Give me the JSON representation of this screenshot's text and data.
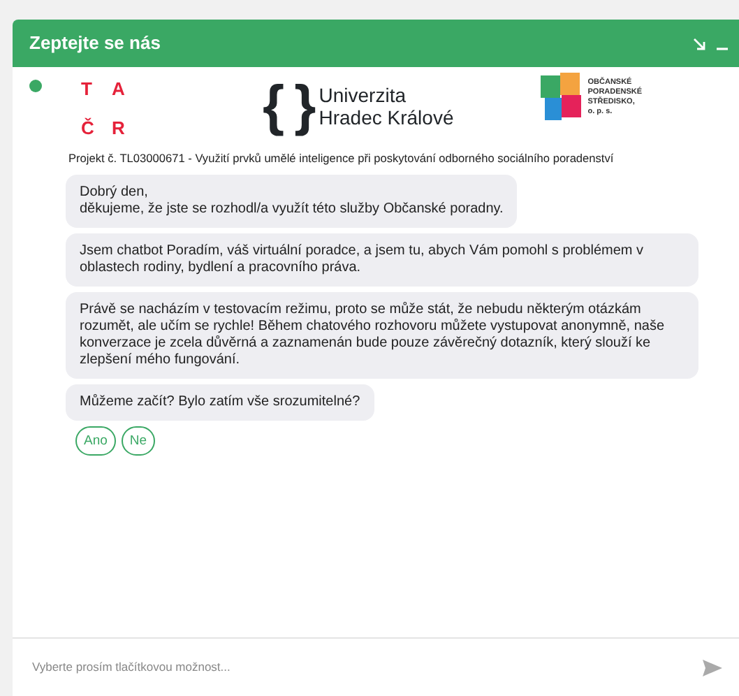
{
  "header": {
    "title": "Zeptejte se nás"
  },
  "logos": {
    "tacr": [
      "T",
      "A",
      "Č",
      "R"
    ],
    "uhk_mark": "{ }",
    "uhk_name": [
      "Univerzita",
      "Hradec Králové"
    ],
    "ops_name": [
      "OBČANSKÉ",
      "PORADENSKÉ",
      "STŘEDISKO,",
      "o. p. s."
    ]
  },
  "project": "Projekt č. TL03000671 - Využití prvků umělé inteligence při poskytování odborného sociálního poradenství",
  "messages": [
    {
      "text": "Dobrý den,\nděkujeme, že jste se rozhodl/a využít této služby Občanské poradny."
    },
    {
      "text": "Jsem chatbot Poradím, váš virtuální poradce, a jsem tu, abych Vám pomohl s problémem v oblastech rodiny, bydlení a pracovního práva."
    },
    {
      "text": "Právě se nacházím v testovacím režimu, proto se může stát, že nebudu některým otázkám rozumět, ale učím se rychle! Během chatového rozhovoru můžete vystupovat anonymně, naše konverzace je zcela důvěrná a zaznamenán bude pouze závěrečný dotazník, který slouží ke zlepšení mého fungování."
    },
    {
      "text": "Můžeme začít? Bylo zatím vše srozumitelné?"
    }
  ],
  "choices": [
    "Ano",
    "Ne"
  ],
  "input": {
    "placeholder": "Vyberte prosím tlačítkovou možnost..."
  }
}
